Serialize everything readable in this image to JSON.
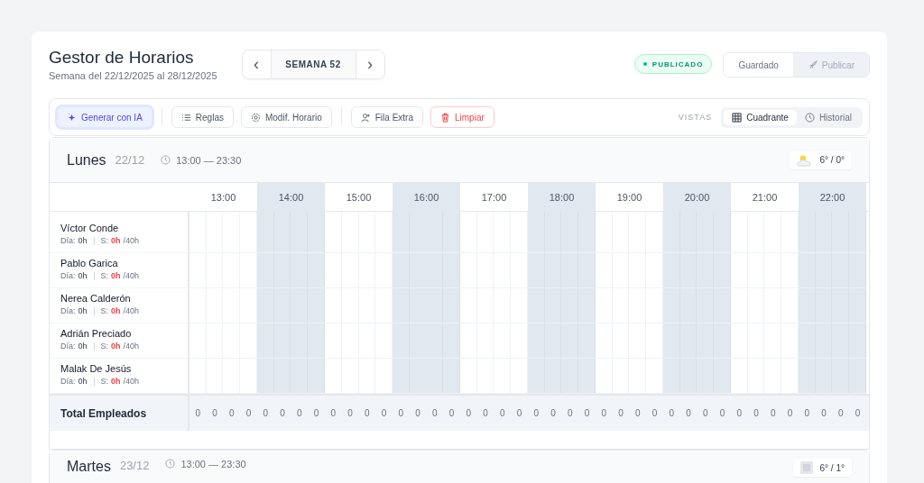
{
  "header": {
    "title": "Gestor de Horarios",
    "subtitle": "Semana del 22/12/2025 al 28/12/2025"
  },
  "week_nav": {
    "prev": "‹",
    "label": "SEMANA 52",
    "next": "›"
  },
  "status_badge": {
    "label": "PUBLICADO",
    "color": "#10b981"
  },
  "save_group": [
    {
      "label": "Guardado",
      "disabled": false,
      "kind": "save"
    },
    {
      "label": "Publicar",
      "disabled": true,
      "kind": "publish"
    }
  ],
  "toolbar": {
    "buttons": [
      {
        "label": "Generar con IA",
        "kind": "ai"
      },
      {
        "label": "Reglas",
        "kind": "rules"
      },
      {
        "label": "Modif. Horario",
        "kind": "settings"
      },
      {
        "label": "Fila Extra",
        "kind": "add-user"
      },
      {
        "label": "Limpiar",
        "kind": "danger"
      }
    ],
    "views_label": "VISTAS",
    "views": [
      {
        "label": "Cuadrante",
        "kind": "grid",
        "selected": true
      },
      {
        "label": "Historial",
        "kind": "clock",
        "selected": false
      }
    ]
  },
  "days": [
    {
      "name": "Lunes",
      "date": "22/12",
      "hours": "13:00 — 23:30",
      "weather": {
        "kind": "sun-cloud",
        "temp": "6° / 0°"
      },
      "columns": [
        {
          "label": "13:00",
          "shaded": false
        },
        {
          "label": "14:00",
          "shaded": true
        },
        {
          "label": "15:00",
          "shaded": false
        },
        {
          "label": "16:00",
          "shaded": true
        },
        {
          "label": "17:00",
          "shaded": false
        },
        {
          "label": "18:00",
          "shaded": true
        },
        {
          "label": "19:00",
          "shaded": false
        },
        {
          "label": "20:00",
          "shaded": true
        },
        {
          "label": "21:00",
          "shaded": false
        },
        {
          "label": "22:00",
          "shaded": true
        }
      ],
      "employees": [
        {
          "name": "Víctor Conde",
          "day_label": "Día:",
          "day_hours": "0h",
          "week_label": "S:",
          "week_hours": "0h",
          "week_limit": "/40h"
        },
        {
          "name": "Pablo Garica",
          "day_label": "Día:",
          "day_hours": "0h",
          "week_label": "S:",
          "week_hours": "0h",
          "week_limit": "/40h"
        },
        {
          "name": "Nerea Calderón",
          "day_label": "Día:",
          "day_hours": "0h",
          "week_label": "S:",
          "week_hours": "0h",
          "week_limit": "/40h"
        },
        {
          "name": "Adrián Preciado",
          "day_label": "Día:",
          "day_hours": "0h",
          "week_label": "S:",
          "week_hours": "0h",
          "week_limit": "/40h"
        },
        {
          "name": "Malak De Jesús",
          "day_label": "Día:",
          "day_hours": "0h",
          "week_label": "S:",
          "week_hours": "0h",
          "week_limit": "/40h"
        }
      ],
      "total_label": "Total Empleados",
      "totals": [
        "0",
        "0",
        "0",
        "0",
        "0",
        "0",
        "0",
        "0",
        "0",
        "0",
        "0",
        "0",
        "0",
        "0",
        "0",
        "0",
        "0",
        "0",
        "0",
        "0",
        "0",
        "0",
        "0",
        "0",
        "0",
        "0",
        "0",
        "0",
        "0",
        "0",
        "0",
        "0",
        "0",
        "0",
        "0",
        "0",
        "0",
        "0",
        "0",
        "0"
      ]
    },
    {
      "name": "Martes",
      "date": "23/12",
      "hours": "13:00 — 23:30",
      "weather": {
        "kind": "placeholder",
        "temp": "6° / 1°"
      }
    }
  ]
}
